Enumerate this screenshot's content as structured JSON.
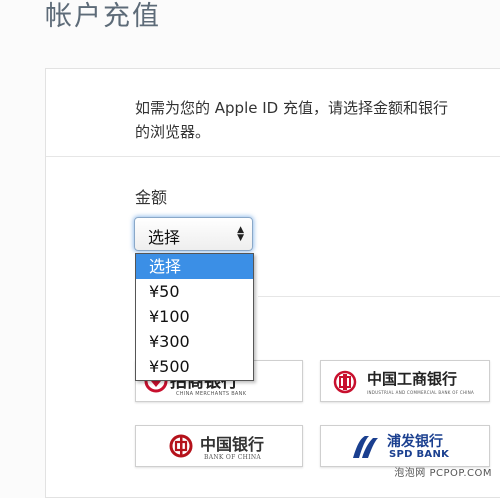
{
  "page": {
    "title": "帐户充值"
  },
  "intro": {
    "line1": "如需为您的 Apple ID 充值，请选择金额和银行",
    "line2": "的浏览器。"
  },
  "amount": {
    "label": "金额",
    "selected": "选择",
    "options": [
      "选择",
      "¥50",
      "¥100",
      "¥300",
      "¥500"
    ]
  },
  "banks": {
    "cmb": {
      "name": "招商银行",
      "sub": "CHINA MERCHANTS BANK"
    },
    "icbc": {
      "name": "中国工商银行",
      "sub": "INDUSTRIAL AND COMMERCIAL BANK OF CHINA"
    },
    "boc": {
      "name": "中国银行",
      "sub": "BANK OF CHINA"
    },
    "spd": {
      "name": "浦发银行",
      "sub": "SPD BANK"
    }
  },
  "watermark": "泡泡网 PCPOP.COM",
  "colors": {
    "highlight": "#3b8fe6",
    "title": "#5d6b78",
    "cmb_red": "#c8102e",
    "icbc_red": "#c8102e",
    "boc_red": "#b5121b",
    "spd_blue": "#1a3f8f"
  }
}
